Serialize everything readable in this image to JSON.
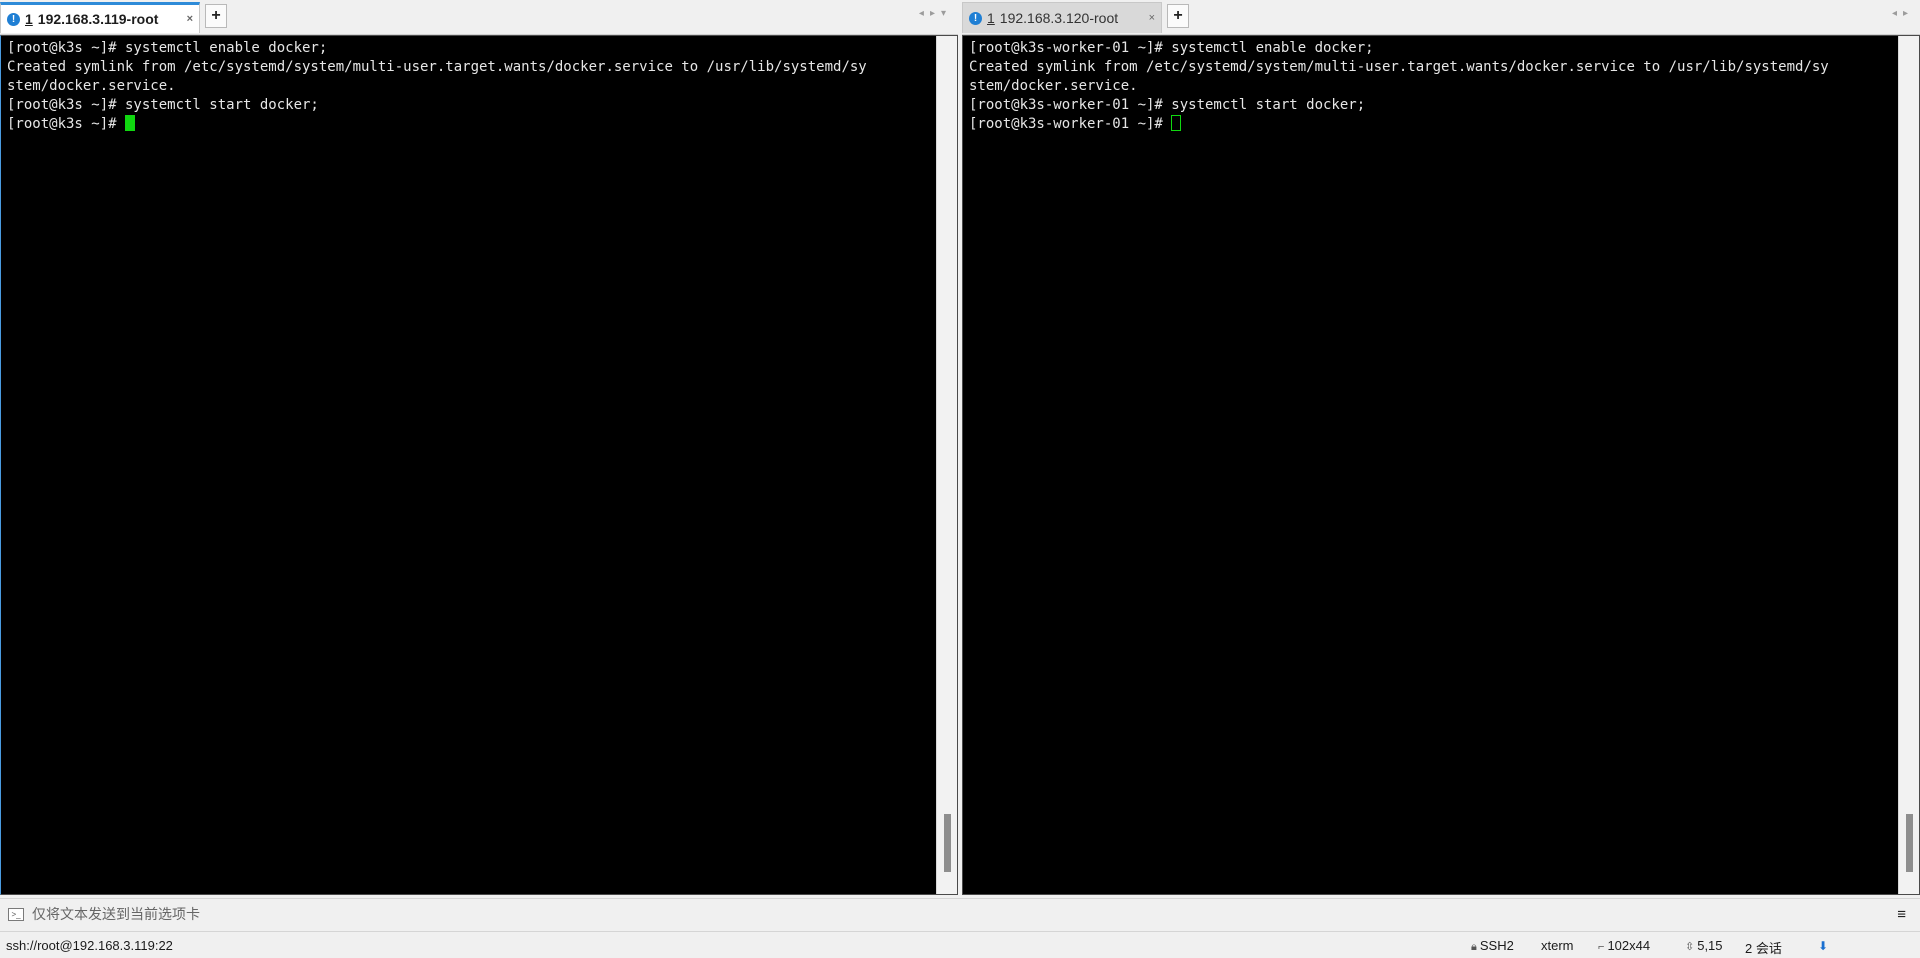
{
  "tabs": {
    "left": {
      "number": "1",
      "label": "192.168.3.119-root",
      "close": "×",
      "add": "+",
      "nav_prev": "◂",
      "nav_next": "▸",
      "nav_menu": "▾"
    },
    "right": {
      "number": "1",
      "label": "192.168.3.120-root",
      "close": "×",
      "add": "+",
      "nav_prev": "◂",
      "nav_next": "▸"
    }
  },
  "terminals": {
    "left": {
      "lines": [
        "[root@k3s ~]# systemctl enable docker;",
        "Created symlink from /etc/systemd/system/multi-user.target.wants/docker.service to /usr/lib/systemd/sy",
        "stem/docker.service.",
        "[root@k3s ~]# systemctl start docker;"
      ],
      "prompt": "[root@k3s ~]# "
    },
    "right": {
      "lines": [
        "[root@k3s-worker-01 ~]# systemctl enable docker;",
        "Created symlink from /etc/systemd/system/multi-user.target.wants/docker.service to /usr/lib/systemd/sy",
        "stem/docker.service.",
        "[root@k3s-worker-01 ~]# systemctl start docker;"
      ],
      "prompt": "[root@k3s-worker-01 ~]# "
    }
  },
  "send_bar": {
    "placeholder": "仅将文本发送到当前选项卡",
    "menu": "≡"
  },
  "status": {
    "connection": "ssh://root@192.168.3.119:22",
    "protocol": "SSH2",
    "terminal": "xterm",
    "size": "102x44",
    "cursor": "5,15",
    "sessions": "2 会话"
  },
  "colors": {
    "accent": "#2e8bd8",
    "cursor": "#10d710",
    "terminal_bg": "#000000",
    "terminal_fg": "#e6e6e6"
  }
}
